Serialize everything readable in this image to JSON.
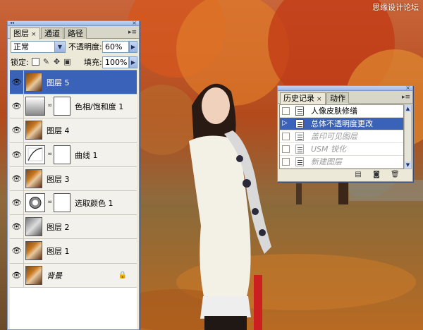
{
  "watermark": "思缘设计论坛",
  "layers_panel": {
    "tabs": [
      {
        "label": "图层",
        "close": "×"
      },
      {
        "label": "通道"
      },
      {
        "label": "路径"
      }
    ],
    "blend_mode": "正常",
    "opacity_label": "不透明度:",
    "opacity_value": "60%",
    "lock_label": "锁定:",
    "fill_label": "填充:",
    "fill_value": "100%",
    "layers": [
      {
        "name": "图层 5",
        "kind": "pixel",
        "selected": true
      },
      {
        "name": "色相/饱和度 1",
        "kind": "adjust-hue"
      },
      {
        "name": "图层 4",
        "kind": "pixel"
      },
      {
        "name": "曲线 1",
        "kind": "adjust-curves"
      },
      {
        "name": "图层 3",
        "kind": "pixel"
      },
      {
        "name": "选取颜色 1",
        "kind": "adjust-selective"
      },
      {
        "name": "图层 2",
        "kind": "pixel-gray"
      },
      {
        "name": "图层 1",
        "kind": "pixel"
      },
      {
        "name": "背景",
        "kind": "background"
      }
    ]
  },
  "history_panel": {
    "tabs": [
      {
        "label": "历史记录",
        "close": "×"
      },
      {
        "label": "动作"
      }
    ],
    "items": [
      {
        "label": "人像皮肤修缮",
        "state": "normal"
      },
      {
        "label": "总体不透明度更改",
        "state": "active"
      },
      {
        "label": "盖印可见图层",
        "state": "dim"
      },
      {
        "label": "USM 锐化",
        "state": "dim"
      },
      {
        "label": "新建图层",
        "state": "dim"
      }
    ]
  },
  "colors": {
    "selection": "#3a62b8",
    "panel_bg": "#ece9d8",
    "panel_border": "#7a96c8"
  }
}
